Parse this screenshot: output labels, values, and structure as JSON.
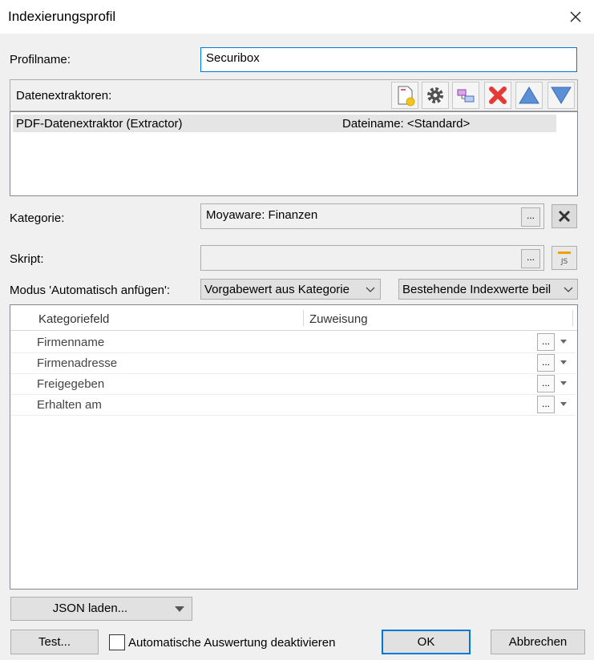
{
  "window": {
    "title": "Indexierungsprofil"
  },
  "profile": {
    "label": "Profilname:",
    "value": "Securibox"
  },
  "extractors": {
    "label": "Datenextraktoren:",
    "toolbar_icons": [
      "new-document-icon",
      "gear-icon",
      "link-blocks-icon",
      "delete-x-icon",
      "move-up-icon",
      "move-down-icon"
    ],
    "items": [
      {
        "name": "PDF-Datenextraktor (Extractor)",
        "filename": "Dateiname: <Standard>"
      }
    ]
  },
  "category": {
    "label": "Kategorie:",
    "value": "Moyaware: Finanzen",
    "browse": "..."
  },
  "script": {
    "label": "Skript:",
    "value": "",
    "browse": "...",
    "js_icon": "JS"
  },
  "mode": {
    "label": "Modus 'Automatisch anfügen':",
    "option1": "Vorgabewert aus Kategorie",
    "option2": "Bestehende Indexwerte beil"
  },
  "grid": {
    "headers": [
      "Kategoriefeld",
      "Zuweisung"
    ],
    "rows": [
      {
        "field": "Firmenname",
        "assign": "",
        "browse": "..."
      },
      {
        "field": "Firmenadresse",
        "assign": "",
        "browse": "..."
      },
      {
        "field": "Freigegeben",
        "assign": "",
        "browse": "..."
      },
      {
        "field": "Erhalten am",
        "assign": "",
        "browse": "..."
      }
    ]
  },
  "buttons": {
    "json": "JSON laden...",
    "test": "Test...",
    "auto_disable": "Automatische Auswertung deaktivieren",
    "ok": "OK",
    "cancel": "Abbrechen"
  },
  "colors": {
    "accent": "#0078d7",
    "delete": "#e53935",
    "arrow": "#5b8fd6",
    "gear": "#505050"
  }
}
